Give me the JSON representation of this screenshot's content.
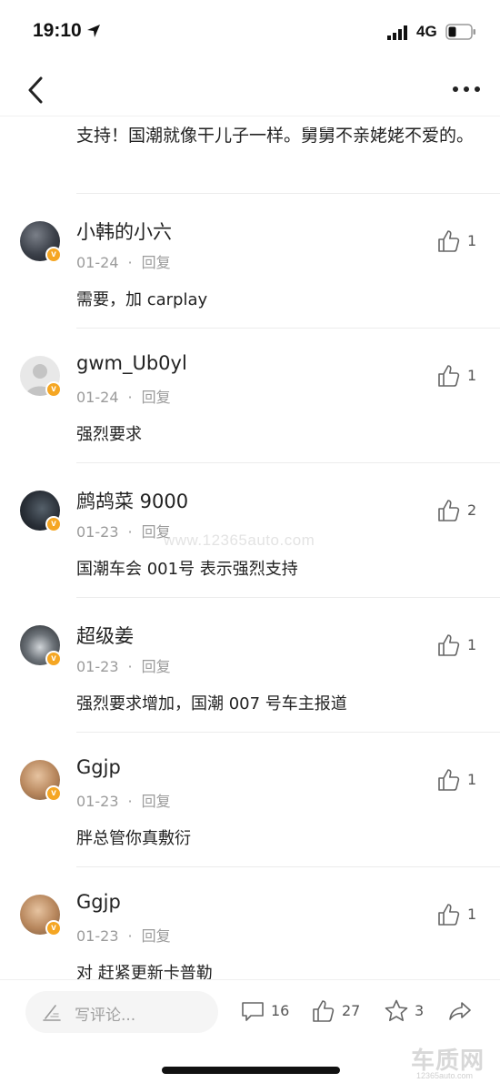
{
  "status_bar": {
    "time": "19:10",
    "network": "4G"
  },
  "top_comment": {
    "text": "支持！国潮就像干儿子一样。舅舅不亲姥姥不爱的。"
  },
  "comments": [
    {
      "name": "小韩的小六",
      "date": "01-24",
      "reply": "回复",
      "body": "需要，加 carplay",
      "likes": "1",
      "badge": "v"
    },
    {
      "name": "gwm_Ub0yl",
      "date": "01-24",
      "reply": "回复",
      "body": "强烈要求",
      "likes": "1",
      "badge": "v"
    },
    {
      "name": "鹧鸪菜 9000",
      "date": "01-23",
      "reply": "回复",
      "body": "国潮车会 001号 表示强烈支持",
      "likes": "2",
      "badge": "v"
    },
    {
      "name": "超级姜",
      "date": "01-23",
      "reply": "回复",
      "body": "强烈要求增加，国潮 007 号车主报道",
      "likes": "1",
      "badge": "v"
    },
    {
      "name": "Ggjp",
      "date": "01-23",
      "reply": "回复",
      "body": "胖总管你真敷衍",
      "likes": "1",
      "badge": "v"
    },
    {
      "name": "Ggjp",
      "date": "01-23",
      "reply": "回复",
      "body": "对 赶紧更新卡普勒",
      "likes": "1",
      "badge": "v"
    }
  ],
  "meta_separator": "·",
  "watermark": "www.12365auto.com",
  "bottom_bar": {
    "input_placeholder": "写评论...",
    "comments_count": "16",
    "likes_count": "27",
    "favorites_count": "3"
  },
  "site_logo": {
    "name": "车质网",
    "url_text": "12365auto.com"
  },
  "icons": {
    "back": "chevron-left-icon",
    "more": "more-dots-icon",
    "like": "thumbs-up-icon",
    "comment": "comment-bubble-icon",
    "star": "star-icon",
    "share": "share-arrow-icon",
    "pen": "pen-icon"
  },
  "colors": {
    "badge": "#f5a623",
    "meta_text": "#9b9b9b",
    "body_text": "#222222"
  }
}
